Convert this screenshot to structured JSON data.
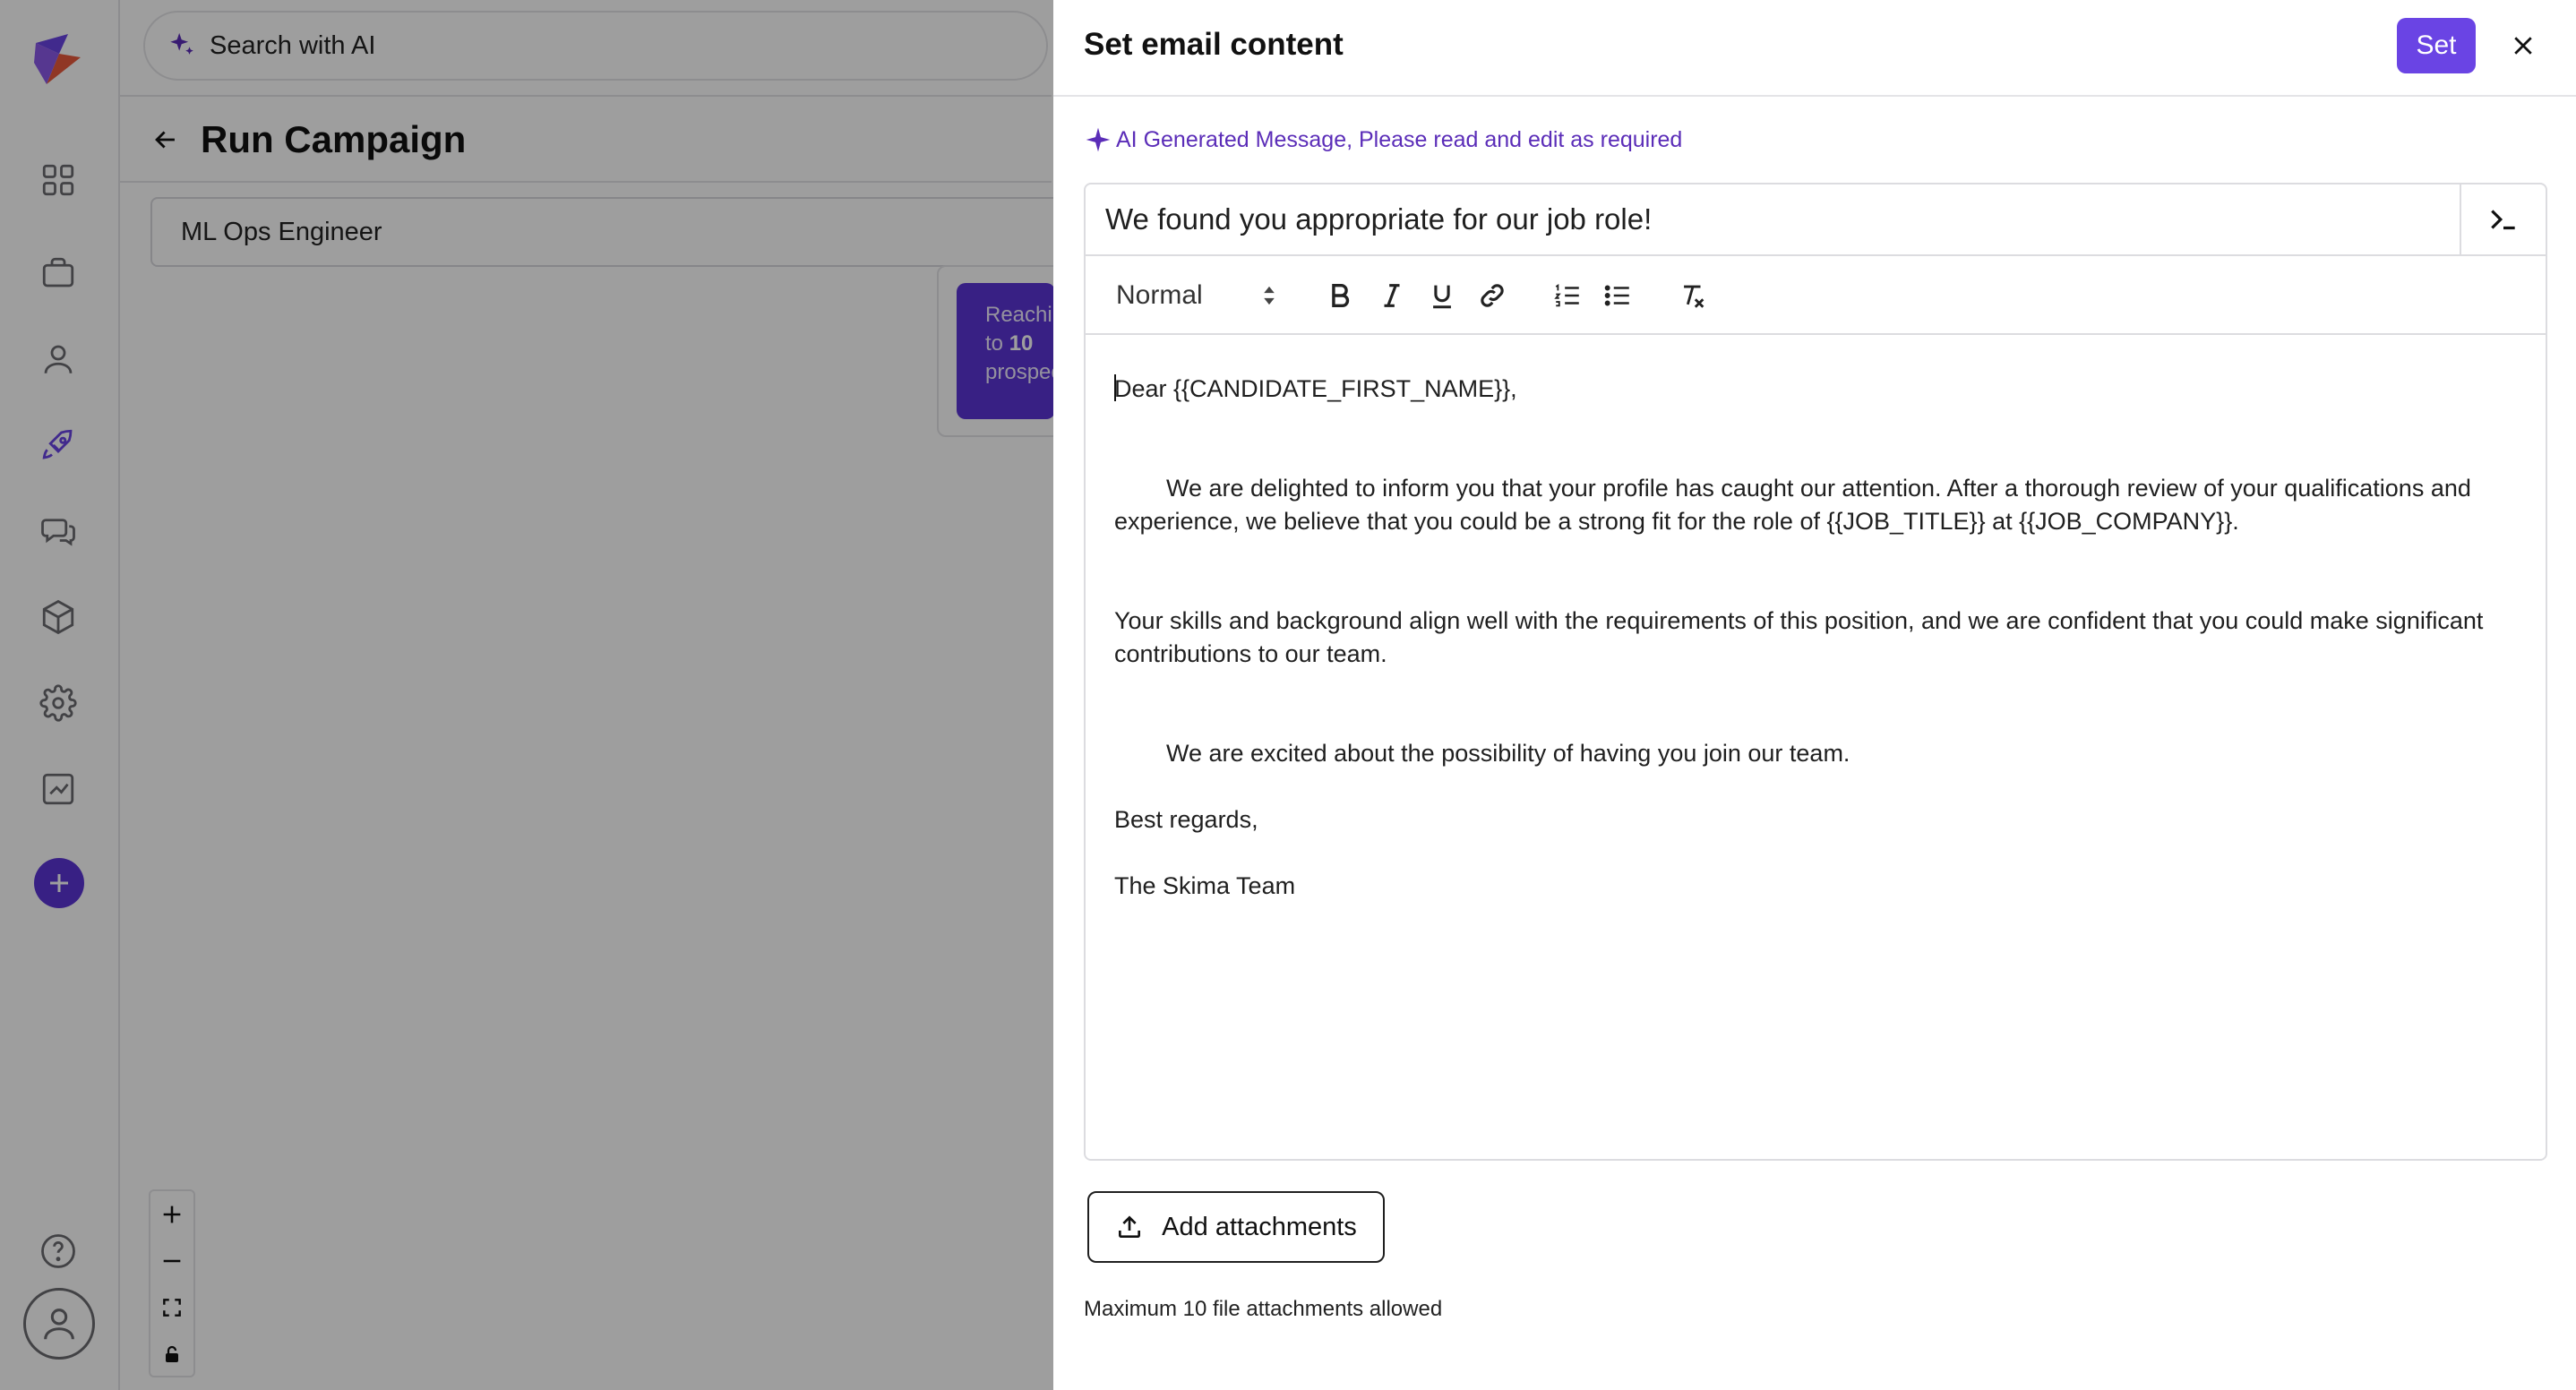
{
  "app": {
    "search_placeholder": "Search with AI",
    "page_title": "Run Campaign",
    "job_select_value": "ML Ops Engineer",
    "node": {
      "line1": "Reaching",
      "line2_prefix": "to",
      "line2_value": "10",
      "line3": "prospects"
    }
  },
  "drawer": {
    "title": "Set email content",
    "set_label": "Set",
    "ai_note": "AI Generated Message, Please read and edit as required",
    "subject_value": "We found you appropriate for our job role!",
    "format_select": "Normal",
    "body": {
      "greeting": "Dear {{CANDIDATE_FIRST_NAME}},",
      "para1": "We are delighted to inform you that your profile has caught our attention. After a thorough review of your qualifications and experience, we believe that you could be a strong fit for the role of {{JOB_TITLE}} at {{JOB_COMPANY}}.",
      "para2": "Your skills and background align well with the requirements of this position, and we are confident that you could make significant contributions to our team.",
      "para3": "We are excited about the possibility of having you join our team.",
      "closing": "Best regards,",
      "signature": "The Skima Team"
    },
    "attach_label": "Add attachments",
    "attach_note": "Maximum 10 file attachments allowed"
  },
  "colors": {
    "accent": "#6a44e4",
    "ai_purple": "#5b2db8",
    "overlay": "rgba(0,0,0,0.38)"
  },
  "icons": [
    "logo-icon",
    "dashboard-icon",
    "briefcase-icon",
    "user-icon",
    "rocket-icon",
    "chat-icon",
    "cube-icon",
    "gear-icon",
    "chart-icon",
    "plus-icon",
    "help-icon",
    "avatar-icon",
    "sparkle-icon",
    "arrow-left-icon",
    "close-icon",
    "terminal-icon",
    "bold-icon",
    "italic-icon",
    "underline-icon",
    "link-icon",
    "ordered-list-icon",
    "bullet-list-icon",
    "clear-format-icon",
    "upload-icon",
    "zoom-in-icon",
    "zoom-out-icon",
    "fit-view-icon",
    "lock-icon"
  ]
}
